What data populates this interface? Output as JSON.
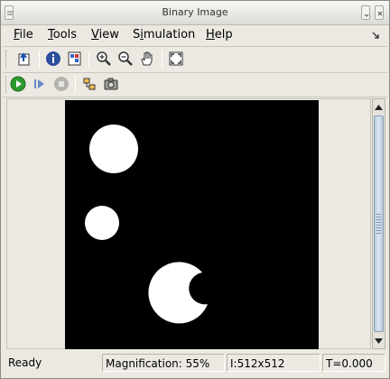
{
  "window": {
    "title": "Binary Image"
  },
  "menu": {
    "file": "File",
    "tools": "Tools",
    "view": "View",
    "simulation": "Simulation",
    "help": "Help"
  },
  "toolbar1": {
    "icons": [
      "open-icon",
      "info-icon",
      "pixel-region-icon",
      "zoom-in-icon",
      "zoom-out-icon",
      "pan-hand-icon",
      "fit-to-window-icon"
    ]
  },
  "toolbar2": {
    "icons": [
      "start-icon",
      "step-forward-icon",
      "stop-icon",
      "highlight-model-icon",
      "snapshot-icon"
    ]
  },
  "status": {
    "state": "Ready",
    "magnification": "Magnification: 55%",
    "dimensions": "I:512x512",
    "time": "T=0.000"
  },
  "colors": {
    "image_background": "#000000",
    "blob": "#ffffff",
    "play_green": "#2e9a2e",
    "info_blue": "#2b4f9c"
  }
}
